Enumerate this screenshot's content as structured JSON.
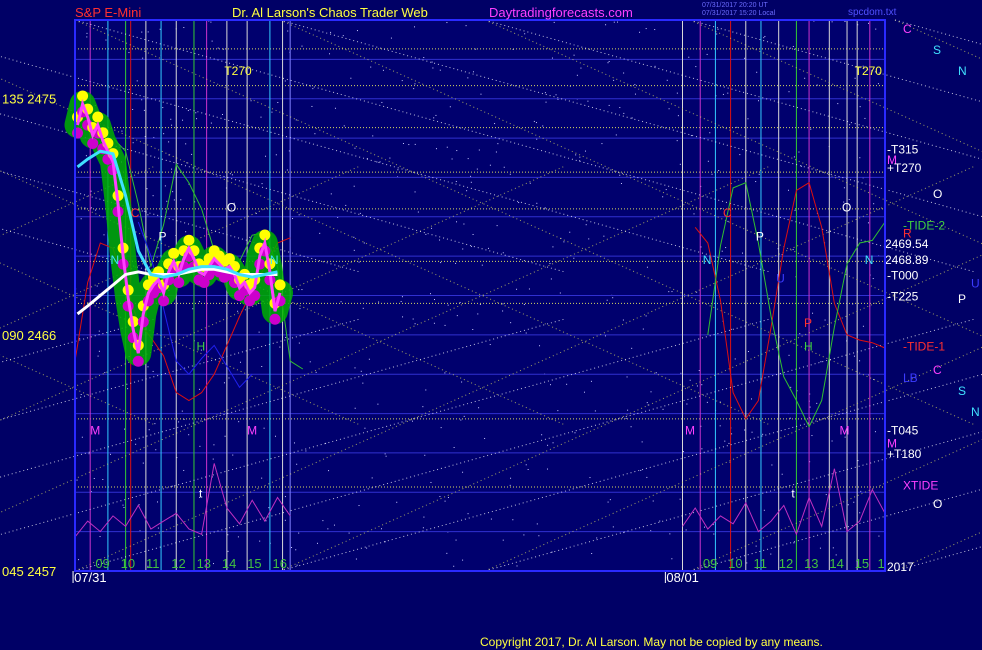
{
  "header": {
    "symbol": "S&P E-Mini",
    "site": "Dr. Al Larson's Chaos Trader Web",
    "url": "Daytradingforecasts.com",
    "stamp_line1": "07/31/2017 20:20 UT",
    "stamp_line2": "07/31/2017 15:20 Local",
    "file": "spcdom.txt"
  },
  "footer": {
    "copyright": "Copyright 2017, Dr. Al Larson. May not be copied by any means."
  },
  "colors": {
    "background": "#000066",
    "frame": "#2a2aff",
    "grid_blue": "#3030d0",
    "grid_yellow": "#d8d860",
    "green_band": "#00b000",
    "yellow_dot": "#ffff00",
    "magenta_dot": "#cc00cc",
    "cyan": "#40e0ff",
    "white": "#ffffff",
    "red": "#dd1010",
    "green": "#30c030",
    "magenta": "#c030c0",
    "blue": "#2020ee",
    "label_yellow": "#ffff40",
    "label_red": "#ff3030"
  },
  "chart_data": {
    "type": "line",
    "y_axis": {
      "ylim": [
        2457,
        2478
      ],
      "ticks": [
        {
          "left": "135",
          "value": 2475
        },
        {
          "left": "090",
          "value": 2466
        },
        {
          "left": "045",
          "value": 2457
        }
      ]
    },
    "x_axis": {
      "date_labels": [
        {
          "text": "07/31",
          "hour": 8.2
        },
        {
          "text": "08/01",
          "hour": 31.6
        }
      ],
      "hour_ticks": [
        {
          "label": "09",
          "hour": 9
        },
        {
          "label": "10",
          "hour": 10
        },
        {
          "label": "11",
          "hour": 11
        },
        {
          "label": "12",
          "hour": 12
        },
        {
          "label": "13",
          "hour": 13
        },
        {
          "label": "14",
          "hour": 14
        },
        {
          "label": "15",
          "hour": 15
        },
        {
          "label": "16",
          "hour": 16
        },
        {
          "label": "09",
          "hour": 33
        },
        {
          "label": "10",
          "hour": 34
        },
        {
          "label": "11",
          "hour": 35
        },
        {
          "label": "12",
          "hour": 36
        },
        {
          "label": "13",
          "hour": 37
        },
        {
          "label": "14",
          "hour": 38
        },
        {
          "label": "15",
          "hour": 39
        },
        {
          "label": "1",
          "hour": 39.9
        }
      ],
      "xlim": [
        8.0,
        40.0
      ]
    },
    "price_readouts": [
      {
        "label": "2469.54",
        "value": 2469.5
      },
      {
        "label": "2468.89",
        "value": 2468.9
      }
    ],
    "right_labels": [
      {
        "text": "C",
        "color": "magenta",
        "value": 2477.7,
        "col": 1
      },
      {
        "text": "S",
        "color": "cyan",
        "value": 2476.9,
        "col": 2
      },
      {
        "text": "N",
        "color": "cyan",
        "value": 2476.1,
        "col": 3
      },
      {
        "text": "-T315",
        "color": "white",
        "value": 2473.1,
        "col": 0
      },
      {
        "text": "M",
        "color": "magenta",
        "value": 2472.7,
        "col": 0
      },
      {
        "text": "+T270",
        "color": "white",
        "value": 2472.4,
        "col": 0
      },
      {
        "text": "O",
        "color": "white",
        "value": 2471.4,
        "col": 2
      },
      {
        "text": "-TIDE-2",
        "color": "green",
        "value": 2470.2,
        "col": 1
      },
      {
        "text": "R",
        "color": "red",
        "value": 2469.9,
        "col": 1
      },
      {
        "text": "-T000",
        "color": "white",
        "value": 2468.3,
        "col": 0
      },
      {
        "text": "U",
        "color": "blue",
        "value": 2468.0,
        "col": 4
      },
      {
        "text": "P",
        "color": "white",
        "value": 2467.4,
        "col": 3
      },
      {
        "text": "-T225",
        "color": "white",
        "value": 2467.5,
        "col": 0
      },
      {
        "text": "-TIDE-1",
        "color": "red",
        "value": 2465.6,
        "col": 1
      },
      {
        "text": "C",
        "color": "magenta",
        "value": 2464.7,
        "col": 2
      },
      {
        "text": "LB",
        "color": "blue",
        "value": 2464.4,
        "col": 1
      },
      {
        "text": "S",
        "color": "cyan",
        "value": 2463.9,
        "col": 3
      },
      {
        "text": "N",
        "color": "cyan",
        "value": 2463.1,
        "col": 4
      },
      {
        "text": "-T045",
        "color": "white",
        "value": 2462.4,
        "col": 0
      },
      {
        "text": "M",
        "color": "magenta",
        "value": 2461.9,
        "col": 0
      },
      {
        "text": "+T180",
        "color": "white",
        "value": 2461.5,
        "col": 0
      },
      {
        "text": "XTIDE",
        "color": "magenta",
        "value": 2460.3,
        "col": 1
      },
      {
        "text": "O",
        "color": "white",
        "value": 2459.6,
        "col": 2
      },
      {
        "text": "2017",
        "color": "white",
        "value": 2457.2,
        "col": 0
      }
    ],
    "in_chart_labels": [
      {
        "text": "T270",
        "color": "label_yellow",
        "hour": 13.9,
        "value": 2475.9
      },
      {
        "text": "T270",
        "color": "label_yellow",
        "hour": 38.8,
        "value": 2475.9
      },
      {
        "text": "O",
        "color": "white",
        "hour": 14.0,
        "value": 2470.7
      },
      {
        "text": "O",
        "color": "white",
        "hour": 38.3,
        "value": 2470.7
      },
      {
        "text": "C",
        "color": "red",
        "hour": 10.2,
        "value": 2470.5
      },
      {
        "text": "C",
        "color": "red",
        "hour": 33.6,
        "value": 2470.5
      },
      {
        "text": "P",
        "color": "white",
        "hour": 11.3,
        "value": 2469.6
      },
      {
        "text": "P",
        "color": "white",
        "hour": 34.9,
        "value": 2469.6
      },
      {
        "text": "N",
        "color": "cyan",
        "hour": 9.4,
        "value": 2468.7
      },
      {
        "text": "N",
        "color": "cyan",
        "hour": 15.7,
        "value": 2468.7
      },
      {
        "text": "N",
        "color": "cyan",
        "hour": 32.8,
        "value": 2468.7
      },
      {
        "text": "N",
        "color": "cyan",
        "hour": 39.2,
        "value": 2468.7
      },
      {
        "text": "U",
        "color": "blue",
        "hour": 35.7,
        "value": 2468.0
      },
      {
        "text": "P",
        "color": "red",
        "hour": 36.8,
        "value": 2466.3
      },
      {
        "text": "H",
        "color": "green",
        "hour": 12.8,
        "value": 2465.4
      },
      {
        "text": "H",
        "color": "green",
        "hour": 36.8,
        "value": 2465.4
      },
      {
        "text": "M",
        "color": "magenta",
        "hour": 8.6,
        "value": 2462.2
      },
      {
        "text": "M",
        "color": "magenta",
        "hour": 14.8,
        "value": 2462.2
      },
      {
        "text": "M",
        "color": "magenta",
        "hour": 32.1,
        "value": 2462.2
      },
      {
        "text": "M",
        "color": "magenta",
        "hour": 38.2,
        "value": 2462.2
      },
      {
        "text": "t",
        "color": "white",
        "hour": 12.9,
        "value": 2459.8
      },
      {
        "text": "t",
        "color": "white",
        "hour": 36.3,
        "value": 2459.8
      }
    ],
    "series": [
      {
        "key": "price",
        "x": [
          8.1,
          8.3,
          8.5,
          8.7,
          8.9,
          9.1,
          9.3,
          9.5,
          9.7,
          9.9,
          10.1,
          10.3,
          10.5,
          10.7,
          10.9,
          11.1,
          11.3,
          11.5,
          11.7,
          11.9,
          12.1,
          12.3,
          12.5,
          12.7,
          12.9,
          13.1,
          13.3,
          13.5,
          13.7,
          13.9,
          14.1,
          14.3,
          14.5,
          14.7,
          14.9,
          15.1,
          15.3,
          15.5,
          15.7,
          15.9,
          16.1
        ],
        "values": [
          2474.0,
          2474.8,
          2474.3,
          2473.6,
          2474.0,
          2473.4,
          2473.0,
          2472.6,
          2471.0,
          2469.0,
          2467.4,
          2466.2,
          2465.3,
          2466.8,
          2467.6,
          2467.9,
          2468.1,
          2467.6,
          2468.4,
          2468.8,
          2468.3,
          2468.9,
          2469.3,
          2468.9,
          2468.4,
          2468.3,
          2468.6,
          2468.9,
          2468.7,
          2468.5,
          2468.6,
          2468.3,
          2467.8,
          2468.0,
          2467.6,
          2467.8,
          2469.0,
          2469.5,
          2468.4,
          2466.9,
          2467.6
        ]
      },
      {
        "key": "average_cyan",
        "x": [
          8.1,
          8.5,
          9.0,
          9.5,
          10.0,
          10.5,
          11.0,
          11.5,
          12.0,
          12.5,
          13.0,
          13.5,
          14.0,
          14.5,
          15.0,
          15.5,
          16.0
        ],
        "values": [
          2472.4,
          2472.7,
          2473.0,
          2472.9,
          2471.3,
          2469.2,
          2468.3,
          2468.2,
          2468.3,
          2468.5,
          2468.6,
          2468.6,
          2468.5,
          2468.3,
          2468.2,
          2468.3,
          2468.4
        ]
      },
      {
        "key": "average_white",
        "x": [
          8.1,
          8.5,
          9.0,
          9.5,
          10.0,
          10.5,
          11.0,
          11.5,
          12.0,
          12.5,
          13.0,
          13.5,
          14.0,
          14.5,
          15.0,
          15.5,
          16.0
        ],
        "values": [
          2466.8,
          2467.1,
          2467.5,
          2467.9,
          2468.3,
          2468.4,
          2468.3,
          2468.3,
          2468.3,
          2468.4,
          2468.5,
          2468.5,
          2468.4,
          2468.3,
          2468.3,
          2468.3,
          2468.3
        ]
      },
      {
        "key": "tide_green",
        "x": [
          9.5,
          10.0,
          10.5,
          11.0,
          11.5,
          12.0,
          12.5,
          13.0,
          13.5,
          14.0,
          14.5,
          15.0,
          15.5,
          16.0,
          16.5,
          17.0,
          33.0,
          33.5,
          34.0,
          34.5,
          35.0,
          35.5,
          36.0,
          36.5,
          37.0,
          37.5,
          38.0,
          38.5,
          39.0,
          39.5,
          40.0
        ],
        "values": [
          2473.5,
          2473.0,
          2471.0,
          2468.6,
          2470.2,
          2472.5,
          2471.8,
          2470.8,
          2469.2,
          2468.2,
          2468.8,
          2469.8,
          2469.9,
          2468.6,
          2465.0,
          2464.7,
          2466.0,
          2469.4,
          2471.6,
          2471.8,
          2469.5,
          2466.7,
          2464.4,
          2463.5,
          2462.5,
          2463.5,
          2466.3,
          2468.7,
          2469.5,
          2469.6,
          2470.3
        ]
      },
      {
        "key": "tide_red",
        "x": [
          8.0,
          8.5,
          9.0,
          9.5,
          10.0,
          10.5,
          11.0,
          11.5,
          12.0,
          12.5,
          13.0,
          13.5,
          14.0,
          14.5,
          15.0,
          15.5,
          16.0,
          16.5,
          32.5,
          33.0,
          33.5,
          34.0,
          34.5,
          35.0,
          35.5,
          36.0,
          36.5,
          37.0,
          37.5,
          38.0,
          38.5,
          39.0,
          39.5,
          40.0
        ],
        "values": [
          2465.0,
          2468.0,
          2469.5,
          2469.3,
          2467.8,
          2466.5,
          2465.9,
          2465.2,
          2463.8,
          2463.5,
          2463.8,
          2464.5,
          2465.6,
          2466.7,
          2467.7,
          2468.6,
          2469.5,
          2469.7,
          2470.1,
          2469.5,
          2467.3,
          2463.8,
          2462.8,
          2463.5,
          2466.3,
          2469.3,
          2471.5,
          2471.8,
          2470.1,
          2467.2,
          2466.0,
          2465.8,
          2465.7,
          2465.5
        ]
      },
      {
        "key": "blue_line",
        "x": [
          10.5,
          11.0,
          11.5,
          12.0,
          12.5,
          13.0,
          13.5,
          14.0,
          14.5,
          15.0
        ],
        "values": [
          2470.3,
          2469.0,
          2467.0,
          2465.0,
          2464.5,
          2465.1,
          2465.6,
          2464.8,
          2464.0,
          2464.5
        ]
      },
      {
        "key": "xtide",
        "x": [
          8.0,
          8.5,
          9.0,
          9.5,
          10.0,
          10.5,
          11.0,
          11.5,
          12.0,
          12.5,
          13.0,
          13.5,
          14.0,
          14.5,
          15.0,
          15.5,
          16.0,
          16.5,
          32.0,
          32.5,
          33.0,
          33.5,
          34.0,
          34.5,
          35.0,
          35.5,
          36.0,
          36.5,
          37.0,
          37.5,
          38.0,
          38.5,
          39.0,
          39.5,
          40.0
        ],
        "values": [
          2458.3,
          2458.9,
          2458.5,
          2459.1,
          2458.7,
          2459.5,
          2458.6,
          2458.9,
          2459.2,
          2458.6,
          2458.4,
          2461.1,
          2459.4,
          2458.8,
          2459.7,
          2458.9,
          2459.8,
          2459.1,
          2458.7,
          2459.4,
          2458.6,
          2459.1,
          2458.8,
          2459.6,
          2458.5,
          2458.9,
          2459.5,
          2458.4,
          2459.8,
          2458.7,
          2460.9,
          2458.5,
          2458.9,
          2460.1,
          2459.2
        ]
      }
    ],
    "grid": true
  }
}
